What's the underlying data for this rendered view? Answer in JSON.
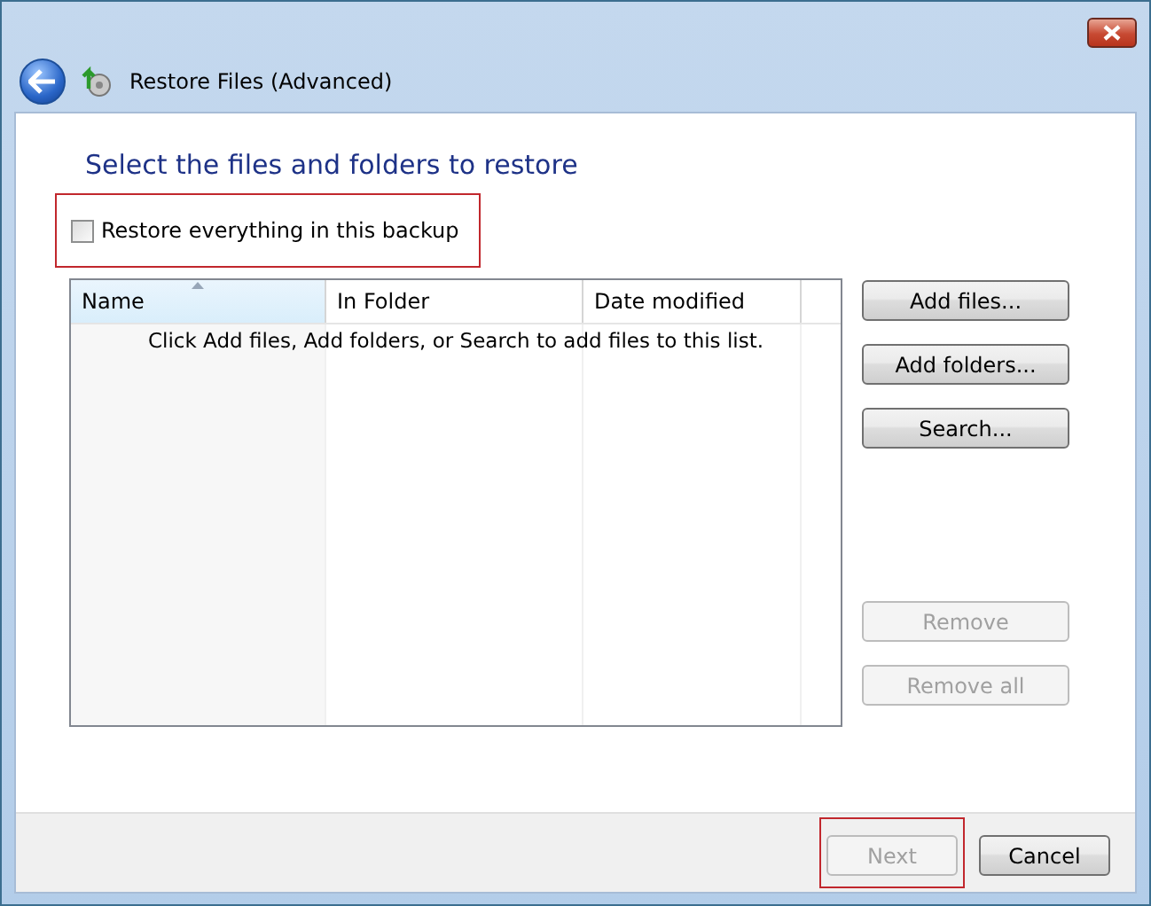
{
  "window": {
    "title": "Restore Files (Advanced)"
  },
  "heading": "Select the files and folders to restore",
  "restore_all": {
    "label": "Restore everything in this backup",
    "checked": false,
    "highlighted": true
  },
  "list": {
    "columns": [
      {
        "label": "Name",
        "sorted": true
      },
      {
        "label": "In Folder",
        "sorted": false
      },
      {
        "label": "Date modified",
        "sorted": false
      }
    ],
    "empty_message": "Click Add files, Add folders, or Search to add files to this list."
  },
  "side_buttons": {
    "top": [
      {
        "label": "Add files...",
        "disabled": false
      },
      {
        "label": "Add folders...",
        "disabled": false
      },
      {
        "label": "Search...",
        "disabled": false
      }
    ],
    "bottom": [
      {
        "label": "Remove",
        "disabled": true
      },
      {
        "label": "Remove all",
        "disabled": true
      }
    ]
  },
  "footer_buttons": [
    {
      "label": "Next",
      "disabled": true,
      "highlighted": true
    },
    {
      "label": "Cancel",
      "disabled": false,
      "highlighted": false
    }
  ]
}
